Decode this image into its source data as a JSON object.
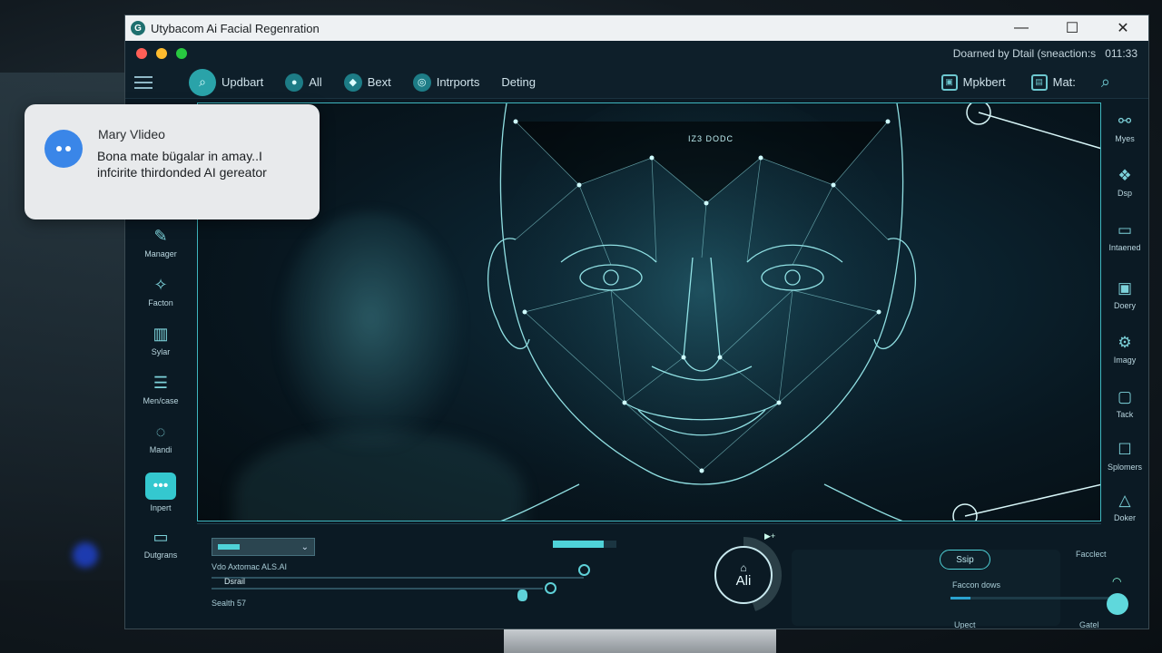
{
  "window": {
    "title": "Utybacom Ai Facial Regenration",
    "logo_glyph": "G",
    "controls": [
      "—",
      "☐",
      "✕"
    ]
  },
  "status": {
    "text": "Doarned by Dtail (sneaction:s",
    "time": "011:33"
  },
  "toolbar": {
    "items": [
      {
        "label": "Updbart",
        "icon": "search-icon"
      },
      {
        "label": "All",
        "icon": "people-icon"
      },
      {
        "label": "Bext",
        "icon": "shield-icon"
      },
      {
        "label": "Intrports",
        "icon": "target-icon"
      },
      {
        "label": "Deting"
      }
    ],
    "right": [
      {
        "label": "Mpkbert",
        "icon": "export-icon"
      },
      {
        "label": "Mat:",
        "icon": "lock-icon"
      }
    ]
  },
  "left_sidebar": [
    {
      "label": "Manager",
      "icon": "chart-icon"
    },
    {
      "label": "Facton",
      "icon": "magic-icon"
    },
    {
      "label": "Sylar",
      "icon": "layers-icon"
    },
    {
      "label": "Men/case",
      "icon": "menu-icon"
    },
    {
      "label": "Mandi",
      "icon": "face-icon"
    },
    {
      "label": "Inpert",
      "icon": "chat-icon"
    },
    {
      "label": "Dutgrans",
      "icon": "list-icon"
    }
  ],
  "right_sidebar": [
    {
      "label": "Myes",
      "icon": "nodes-icon"
    },
    {
      "label": "Dsp",
      "icon": "brain-icon"
    },
    {
      "label": "Intaened",
      "icon": "monitor-icon"
    },
    {
      "label": "Doery",
      "icon": "document-icon"
    },
    {
      "label": "Imagy",
      "icon": "settings-icon"
    },
    {
      "label": "Tack",
      "icon": "display-icon"
    },
    {
      "label": "Splomers",
      "icon": "square-icon"
    },
    {
      "label": "Doker",
      "icon": "warning-icon"
    }
  ],
  "viewer": {
    "caption": "IZ3 DODC"
  },
  "controls": {
    "dropdown_chevron": "⌄",
    "label_1": "Vdo Axtomac ALS.AI",
    "label_2": "Dsrail",
    "label_3": "Sealth 57",
    "progress": 0.8,
    "ai_label": "Ali",
    "play_icon": "▶+",
    "skip_label": "Ssip",
    "faccon_label": "Faccon dows",
    "facclect_label": "Facclect",
    "upect_label": "Upect",
    "gatel_label": "Gatel"
  },
  "notification": {
    "sender": "Mary Vlideo",
    "body": "Bona mate bügalar in amay..I infcirite thirdonded AI gereator"
  },
  "colors": {
    "accent": "#4fd2d8",
    "face": "#9ff4f6",
    "notif_avatar": "#3a86e8"
  }
}
